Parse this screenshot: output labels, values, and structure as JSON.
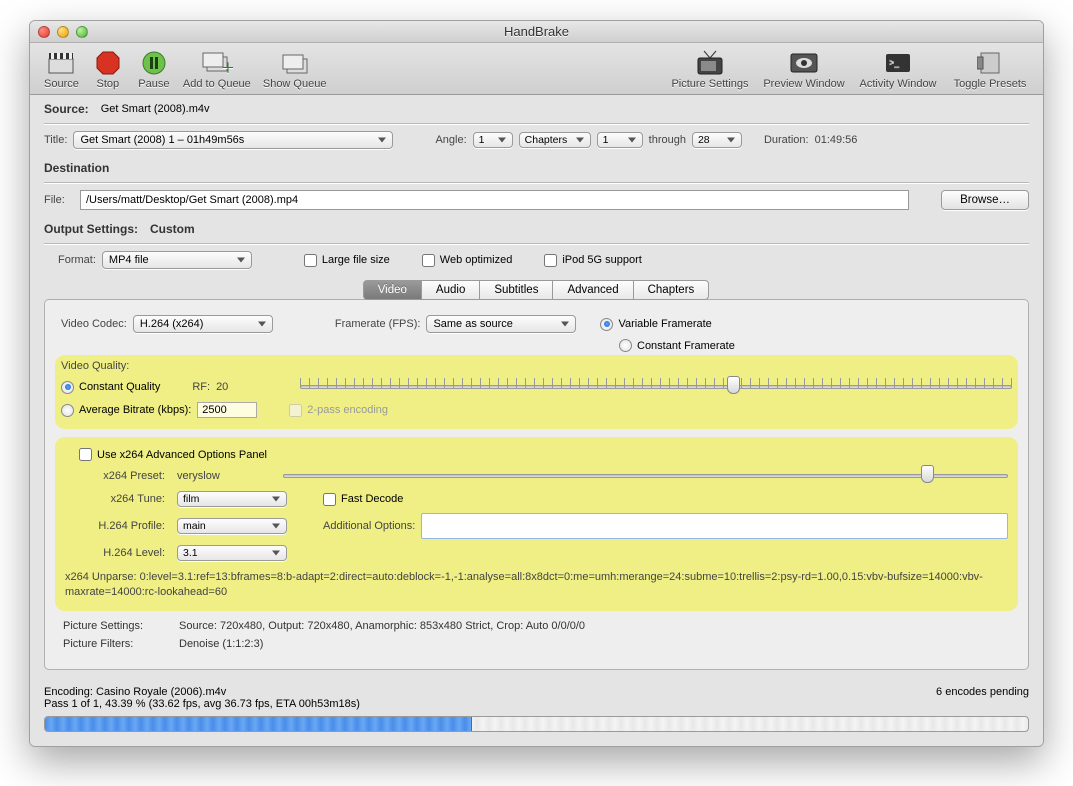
{
  "window": {
    "title": "HandBrake"
  },
  "toolbar": {
    "source": "Source",
    "stop": "Stop",
    "pause": "Pause",
    "add_queue": "Add to Queue",
    "show_queue": "Show Queue",
    "picture_settings": "Picture Settings",
    "preview_window": "Preview Window",
    "activity_window": "Activity Window",
    "toggle_presets": "Toggle Presets"
  },
  "source": {
    "label": "Source:",
    "value": "Get Smart (2008).m4v",
    "title_label": "Title:",
    "title_value": "Get Smart (2008) 1 – 01h49m56s",
    "angle_label": "Angle:",
    "angle_value": "1",
    "chapters_label": "Chapters",
    "chapter_from": "1",
    "through": "through",
    "chapter_to": "28",
    "duration_label": "Duration:",
    "duration_value": "01:49:56"
  },
  "destination": {
    "header": "Destination",
    "file_label": "File:",
    "file_value": "/Users/matt/Desktop/Get Smart (2008).mp4",
    "browse": "Browse…"
  },
  "output": {
    "header": "Output Settings:",
    "preset": "Custom",
    "format_label": "Format:",
    "format_value": "MP4 file",
    "large_file": "Large file size",
    "web_opt": "Web optimized",
    "ipod": "iPod 5G support"
  },
  "tabs": {
    "video": "Video",
    "audio": "Audio",
    "subtitles": "Subtitles",
    "advanced": "Advanced",
    "chapters": "Chapters"
  },
  "video": {
    "codec_label": "Video Codec:",
    "codec_value": "H.264 (x264)",
    "fps_label": "Framerate (FPS):",
    "fps_value": "Same as source",
    "vfr": "Variable Framerate",
    "cfr": "Constant Framerate",
    "quality_header": "Video Quality:",
    "cq_label": "Constant Quality",
    "rf_label": "RF:",
    "rf_value": "20",
    "abr_label": "Average Bitrate (kbps):",
    "abr_value": "2500",
    "two_pass": "2-pass encoding",
    "use_adv": "Use x264 Advanced Options Panel",
    "preset_label": "x264 Preset:",
    "preset_value": "veryslow",
    "tune_label": "x264 Tune:",
    "tune_value": "film",
    "fast_decode": "Fast Decode",
    "profile_label": "H.264 Profile:",
    "profile_value": "main",
    "add_opts_label": "Additional Options:",
    "level_label": "H.264 Level:",
    "level_value": "3.1",
    "unparse": "x264 Unparse: 0:level=3.1:ref=13:bframes=8:b-adapt=2:direct=auto:deblock=-1,-1:analyse=all:8x8dct=0:me=umh:merange=24:subme=10:trellis=2:psy-rd=1.00,0.15:vbv-bufsize=14000:vbv-maxrate=14000:rc-lookahead=60"
  },
  "picture": {
    "settings_label": "Picture Settings:",
    "settings_value": "Source: 720x480, Output: 720x480, Anamorphic: 853x480 Strict, Crop: Auto 0/0/0/0",
    "filters_label": "Picture Filters:",
    "filters_value": "Denoise (1:1:2:3)"
  },
  "status": {
    "encoding_label": "Encoding:",
    "encoding_value": "Casino Royale (2006).m4v",
    "pass": "Pass 1 of 1, 43.39 % (33.62 fps, avg 36.73 fps, ETA 00h53m18s)",
    "pending": "6 encodes pending",
    "progress_pct": 43.39
  }
}
